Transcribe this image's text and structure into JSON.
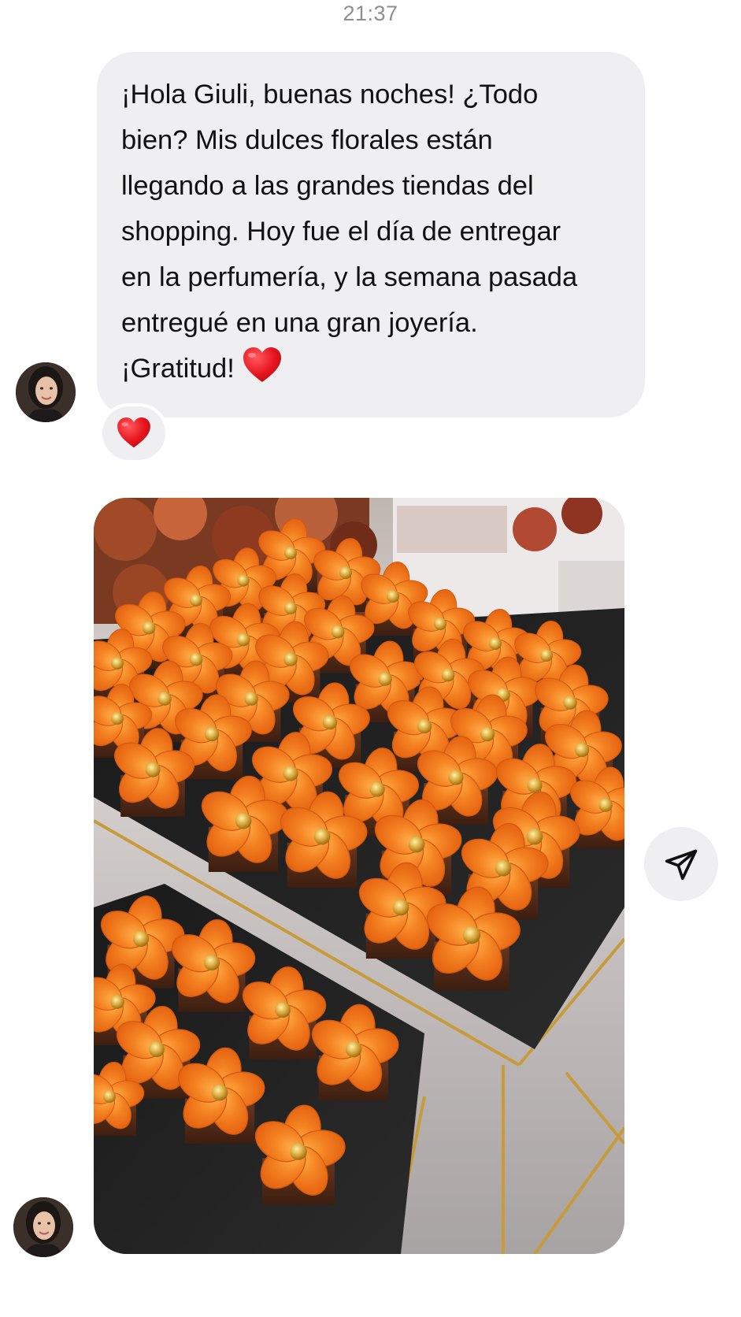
{
  "conversation": {
    "timestamp": "21:37",
    "message": {
      "text": "¡Hola Giuli, buenas noches! ¿Todo\nbien? Mis dulces florales están\nllegando a las grandes tiendas del\nshopping. Hoy fue el día de entregar\nen la perfumería, y la semana pasada\nentregué en una gran joyería.\n¡Gratitud!",
      "emoji": "red-heart-emoji",
      "reaction": "red-heart-emoji"
    },
    "attachment": {
      "type": "photo",
      "subject": "orange-flower-chocolates"
    },
    "actions": {
      "share_icon": "paper-plane-icon"
    }
  },
  "colors": {
    "bubble": "#efeff1",
    "timestamp": "#8e8e93",
    "heart": "#e8141e",
    "flower": "#f07a1e",
    "chocolate": "#5b2e18"
  }
}
